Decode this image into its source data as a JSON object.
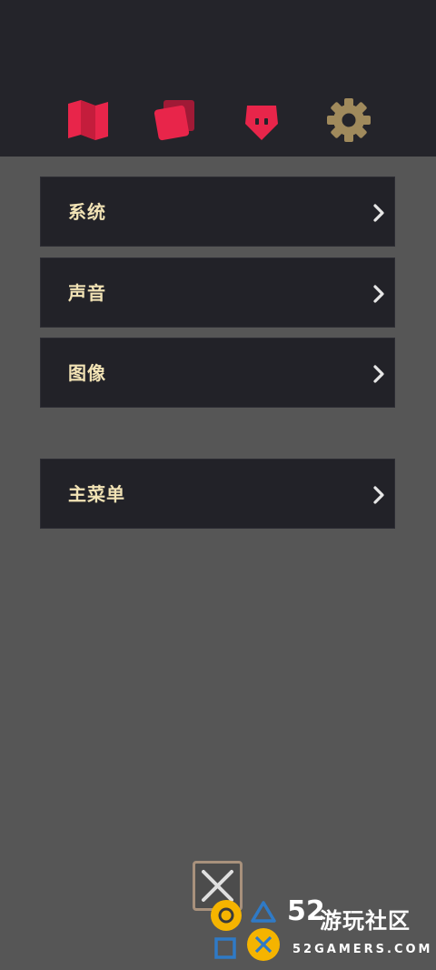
{
  "tabs": [
    {
      "icon": "map-icon",
      "color": "#e8254a"
    },
    {
      "icon": "cards-icon",
      "color": "#e8254a"
    },
    {
      "icon": "character-mask-icon",
      "color": "#e8254a"
    },
    {
      "icon": "gear-icon",
      "color": "#a08a5c",
      "active": true
    }
  ],
  "menu": {
    "items": [
      {
        "label": "系统"
      },
      {
        "label": "声音"
      },
      {
        "label": "图像"
      },
      {
        "label": "主菜单"
      }
    ]
  },
  "close_button": {
    "icon": "close-icon"
  },
  "watermark": {
    "number": "52",
    "name": "游玩社区",
    "url": "52GAMERS.COM"
  },
  "colors": {
    "accent": "#e8254a",
    "label": "#f2e3b5",
    "background": "#565656",
    "bar": "#24242a",
    "item": "#222228"
  }
}
